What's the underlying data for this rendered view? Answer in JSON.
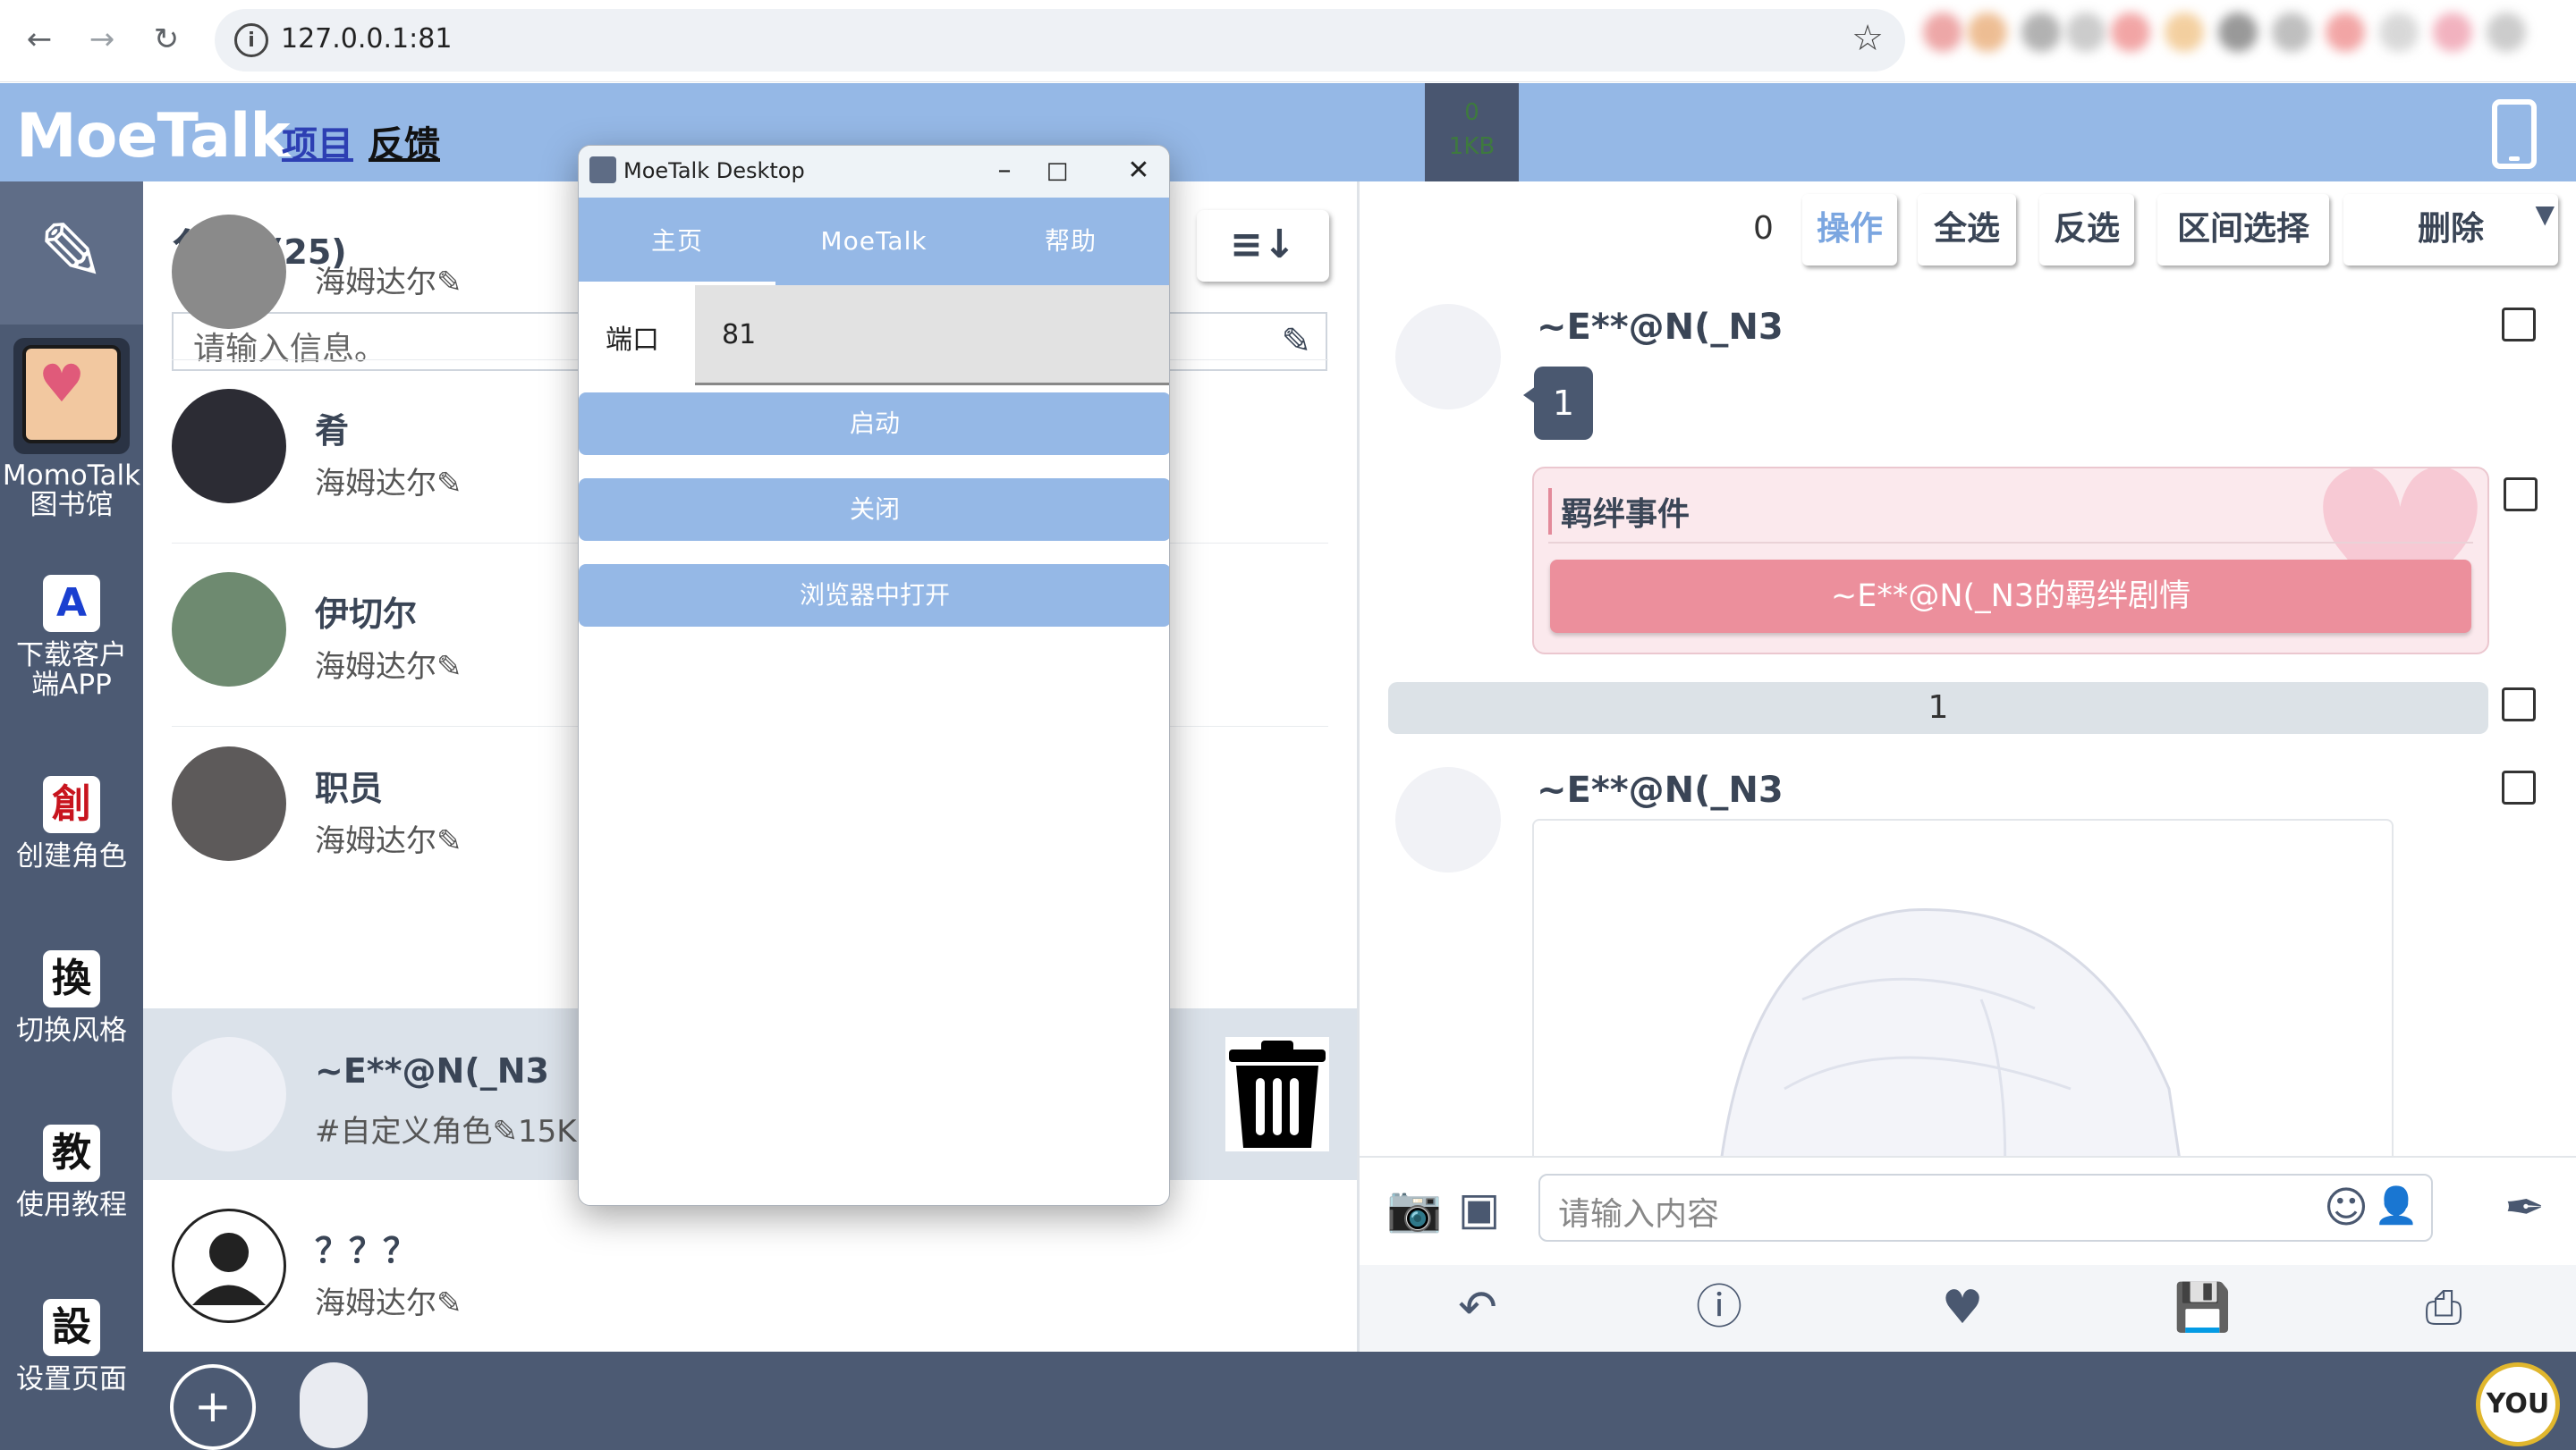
{
  "browser": {
    "url": "127.0.0.1:81"
  },
  "app": {
    "logo": "MoeTalk",
    "nav_project": "项目",
    "nav_feedback": "反馈",
    "size_line1": "0",
    "size_line2": "1KB"
  },
  "sidebar": {
    "items": [
      {
        "label": "MomoTalk\n图书馆",
        "icon": "library-icon"
      },
      {
        "label": "下载客户\n端APP",
        "icon": "A"
      },
      {
        "label": "创建角色",
        "icon": "創"
      },
      {
        "label": "切换风格",
        "icon": "換"
      },
      {
        "label": "使用教程",
        "icon": "教"
      },
      {
        "label": "设置页面",
        "icon": "設"
      }
    ]
  },
  "characters": {
    "title": "角色",
    "count": "(25)",
    "search_placeholder": "请输入信息。",
    "list": [
      {
        "name": "",
        "sub": "海姆达尔"
      },
      {
        "name": "肴",
        "sub": "海姆达尔"
      },
      {
        "name": "伊切尔",
        "sub": "海姆达尔"
      },
      {
        "name": "职员",
        "sub": "海姆达尔"
      },
      {
        "name": "~E**@N(_N3",
        "sub": "#自定义角色",
        "size": "15KB",
        "selected": true
      },
      {
        "name": "？？？",
        "sub": "海姆达尔"
      }
    ]
  },
  "toolbar": {
    "count": "0",
    "operate": "操作",
    "select_all": "全选",
    "invert": "反选",
    "range_select": "区间选择",
    "delete": "删除"
  },
  "chat": {
    "messages": [
      {
        "name": "~E**@N(_N3",
        "text": "1"
      }
    ],
    "bond_title": "羁绊事件",
    "bond_button": "~E**@N(_N3的羁绊剧情",
    "divider_text": "1",
    "second_name": "~E**@N(_N3",
    "input_placeholder": "请输入内容"
  },
  "desktop_window": {
    "title": "MoeTalk Desktop",
    "tabs": [
      "主页",
      "MoeTalk",
      "帮助"
    ],
    "port_label": "端口",
    "port_value": "81",
    "start_button": "启动",
    "close_button": "关闭",
    "open_browser_button": "浏览器中打开"
  },
  "footer": {
    "you_badge": "YOU"
  },
  "colors": {
    "accent": "#95b8e6",
    "sidebar": "#4c5a73",
    "bond_button": "#ec8f9c"
  }
}
